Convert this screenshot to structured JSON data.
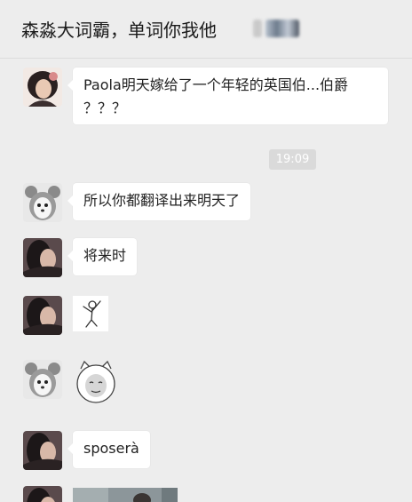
{
  "header": {
    "title": "森淼大词霸，单词你我他"
  },
  "messages": [
    {
      "type": "text",
      "sender_avatar": "girl-avatar",
      "text_line1": "Paola明天嫁给了一个年轻的英国伯...伯爵",
      "text_line2": "？？？"
    },
    {
      "type": "timestamp",
      "text": "19:09"
    },
    {
      "type": "text",
      "sender_avatar": "puppy-mouse-avatar",
      "text": "所以你都翻译出来明天了"
    },
    {
      "type": "text",
      "sender_avatar": "dark-hair-avatar",
      "text": "将来时"
    },
    {
      "type": "sticker",
      "sender_avatar": "dark-hair-avatar",
      "sticker": "dancing-stick-figure-sticker"
    },
    {
      "type": "sticker",
      "sender_avatar": "puppy-mouse-avatar",
      "sticker": "round-face-meme-sticker"
    },
    {
      "type": "text",
      "sender_avatar": "dark-hair-avatar",
      "text": "sposerà"
    },
    {
      "type": "image",
      "sender_avatar": "dark-hair-avatar",
      "content": "photo-preview"
    }
  ],
  "colors": {
    "background": "#ededed",
    "bubble": "#ffffff",
    "timestamp_bg": "#dadada"
  }
}
